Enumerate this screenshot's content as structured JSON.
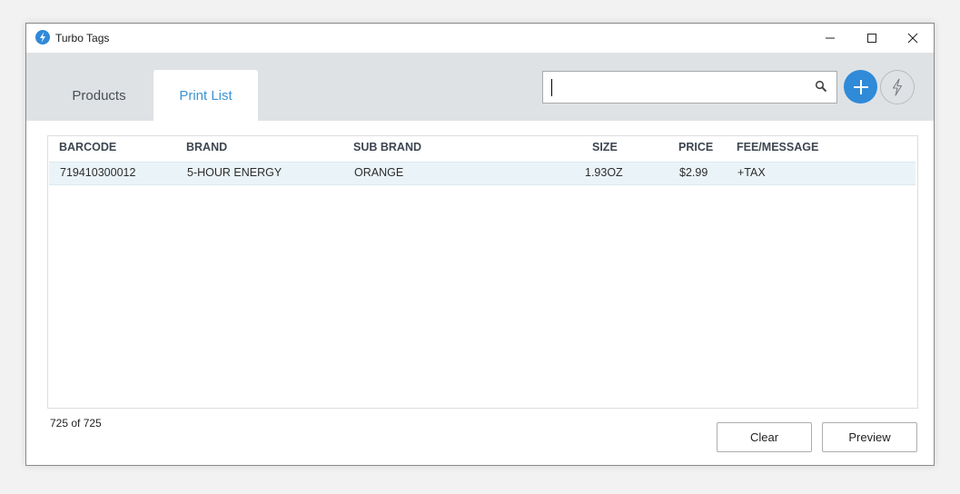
{
  "window": {
    "title": "Turbo Tags"
  },
  "tabs": [
    {
      "label": "Products"
    },
    {
      "label": "Print List"
    }
  ],
  "search": {
    "value": "",
    "placeholder": ""
  },
  "table": {
    "headers": [
      "BARCODE",
      "BRAND",
      "SUB BRAND",
      "SIZE",
      "PRICE",
      "FEE/MESSAGE"
    ],
    "rows": [
      {
        "barcode": "719410300012",
        "brand": "5-HOUR ENERGY",
        "sub_brand": "ORANGE",
        "size": "1.93OZ",
        "price": "$2.99",
        "fee": "+TAX"
      }
    ]
  },
  "footer": {
    "count": "725 of 725",
    "clear_label": "Clear",
    "preview_label": "Preview"
  },
  "colors": {
    "accent": "#2f8ad8",
    "header_bg": "#dee2e5",
    "selected_row": "#eaf4f8"
  },
  "icons": {
    "app": "lightning-bolt-icon",
    "search": "magnifier-icon",
    "add": "plus-icon",
    "turbo": "lightning-bolt-icon"
  }
}
